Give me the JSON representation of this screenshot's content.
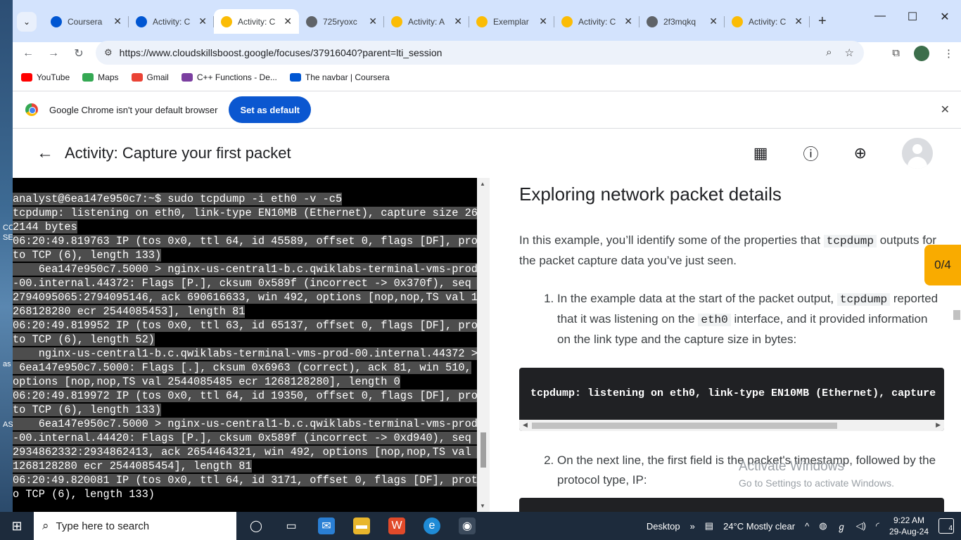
{
  "browser": {
    "tabs": [
      {
        "title": "Coursera",
        "favicon": "coursera-icon",
        "active": false
      },
      {
        "title": "Activity: C",
        "favicon": "coursera-icon",
        "active": false
      },
      {
        "title": "Activity: C",
        "favicon": "cloud-icon",
        "active": true
      },
      {
        "title": "725ryoxc",
        "favicon": "globe-icon",
        "active": false
      },
      {
        "title": "Activity: A",
        "favicon": "cloud-icon",
        "active": false
      },
      {
        "title": "Exemplar",
        "favicon": "cloud-icon",
        "active": false
      },
      {
        "title": "Activity: C",
        "favicon": "cloud-icon",
        "active": false
      },
      {
        "title": "2f3mqkq",
        "favicon": "globe-icon",
        "active": false
      },
      {
        "title": "Activity: C",
        "favicon": "cloud-icon",
        "active": false
      }
    ],
    "url": "https://www.cloudskillsboost.google/focuses/37916040?parent=lti_session",
    "bookmarks": [
      {
        "label": "YouTube",
        "icon": "youtube-icon",
        "color": "#ff0000"
      },
      {
        "label": "Maps",
        "icon": "maps-icon",
        "color": "#34a853"
      },
      {
        "label": "Gmail",
        "icon": "gmail-icon",
        "color": "#ea4335"
      },
      {
        "label": "C++ Functions - De...",
        "icon": "studytonight-icon",
        "color": "#7b3fa0"
      },
      {
        "label": "The navbar | Coursera",
        "icon": "coursera-icon",
        "color": "#0056d2"
      }
    ],
    "infobar": {
      "message": "Google Chrome isn't your default browser",
      "button": "Set as default"
    }
  },
  "page": {
    "title": "Activity: Capture your first packet",
    "terminal_lines": [
      "analyst@6ea147e950c7:~$ sudo tcpdump -i eth0 -v -c5",
      "tcpdump: listening on eth0, link-type EN10MB (Ethernet), capture size 26",
      "2144 bytes",
      "06:20:49.819763 IP (tos 0x0, ttl 64, id 45589, offset 0, flags [DF], pro",
      "to TCP (6), length 133)",
      "    6ea147e950c7.5000 > nginx-us-central1-b.c.qwiklabs-terminal-vms-prod",
      "-00.internal.44372: Flags [P.], cksum 0x589f (incorrect -> 0x370f), seq ",
      "2794095065:2794095146, ack 690616633, win 492, options [nop,nop,TS val 1",
      "268128280 ecr 2544085453], length 81",
      "06:20:49.819952 IP (tos 0x0, ttl 63, id 65137, offset 0, flags [DF], pro",
      "to TCP (6), length 52)",
      "    nginx-us-central1-b.c.qwiklabs-terminal-vms-prod-00.internal.44372 >",
      " 6ea147e950c7.5000: Flags [.], cksum 0x6963 (correct), ack 81, win 510,",
      "options [nop,nop,TS val 2544085485 ecr 1268128280], length 0",
      "06:20:49.819972 IP (tos 0x0, ttl 64, id 19350, offset 0, flags [DF], pro",
      "to TCP (6), length 133)",
      "    6ea147e950c7.5000 > nginx-us-central1-b.c.qwiklabs-terminal-vms-prod",
      "-00.internal.44420: Flags [P.], cksum 0x589f (incorrect -> 0xd940), seq ",
      "2934862332:2934862413, ack 2654464321, win 492, options [nop,nop,TS val ",
      "1268128280 ecr 2544085454], length 81",
      "06:20:49.820081 IP (tos 0x0, ttl 64, id 3171, offset 0, flags [DF], prot",
      "o TCP (6), length 133)"
    ],
    "lesson": {
      "heading": "Exploring network packet details",
      "intro_a": "In this example, you’ll identify some of the properties that ",
      "intro_code": "tcpdump",
      "intro_b": " outputs for the packet capture data you’ve just seen.",
      "step1_a": "In the example data at the start of the packet output, ",
      "step1_code1": "tcpdump",
      "step1_b": " reported that it was listening on the ",
      "step1_code2": "eth0",
      "step1_c": " interface, and it provided information on the link type and the capture size in bytes:",
      "code_example": "tcpdump: listening on eth0, link-type EN10MB (Ethernet), capture",
      "step2": "On the next line, the first field is the packet's timestamp, followed by the protocol type, IP:",
      "progress": "0/4"
    },
    "watermark": {
      "line1": "Activate Windows",
      "line2": "Go to Settings to activate Windows."
    }
  },
  "taskbar": {
    "search_placeholder": "Type here to search",
    "desktop_label": "Desktop",
    "weather": "24°C  Mostly clear",
    "time": "9:22 AM",
    "date": "29-Aug-24",
    "notifications": "4"
  }
}
